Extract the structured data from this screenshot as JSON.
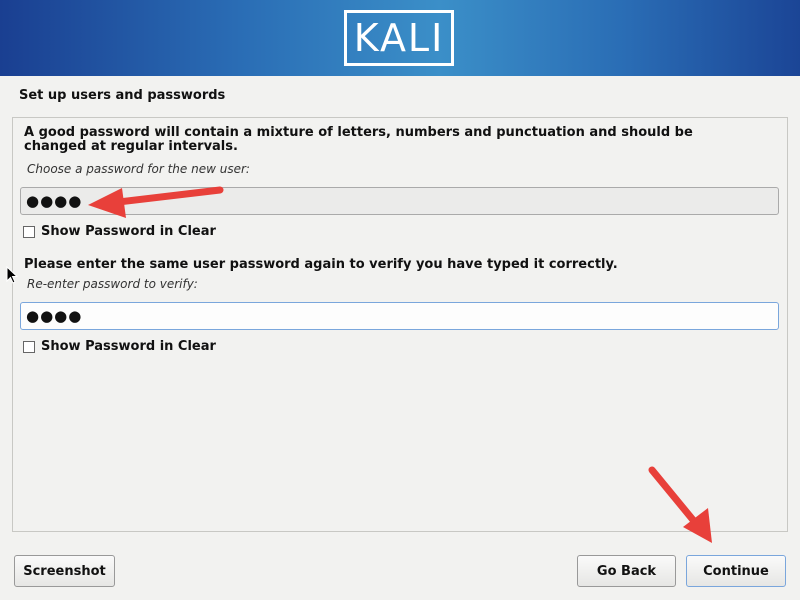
{
  "banner": {
    "logo_text": "KALI"
  },
  "page": {
    "title": "Set up users and passwords"
  },
  "form": {
    "description": "A good password will contain a mixture of letters, numbers and punctuation and should be changed at regular intervals.",
    "password_prompt": "Choose a password for the new user:",
    "password_value": "●●●●",
    "show_password_label_1": "Show Password in Clear",
    "verify_heading": "Please enter the same user password again to verify you have typed it correctly.",
    "verify_prompt": "Re-enter password to verify:",
    "verify_value": "●●●●",
    "show_password_label_2": "Show Password in Clear"
  },
  "buttons": {
    "screenshot": "Screenshot",
    "go_back": "Go Back",
    "continue": "Continue"
  },
  "colors": {
    "annotation_arrow": "#e8403a",
    "focus_border": "#7aa6dc"
  }
}
